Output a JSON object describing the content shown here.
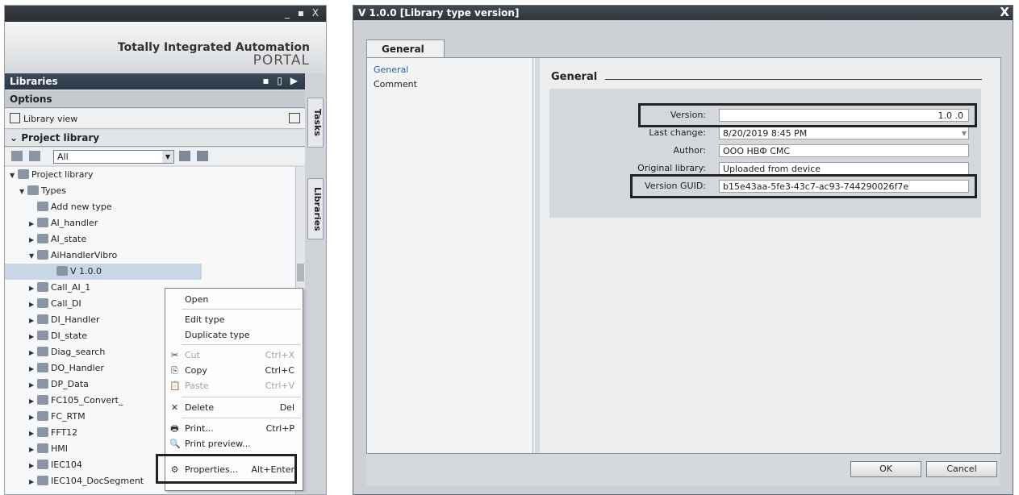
{
  "left_panel": {
    "window_controls": "_ ▪ X",
    "brand_line1": "Totally Integrated Automation",
    "brand_line2": "PORTAL",
    "libraries_title": "Libraries",
    "options_label": "Options",
    "library_view_label": "Library view",
    "project_library_section": "Project library",
    "filter_value": "All",
    "vertical_tabs": [
      "Tasks",
      "Libraries"
    ],
    "tree": [
      {
        "label": "Project library",
        "indent": 0,
        "arrow": "▼"
      },
      {
        "label": "Types",
        "indent": 1,
        "arrow": "▼"
      },
      {
        "label": "Add new type",
        "indent": 2,
        "arrow": ""
      },
      {
        "label": "AI_handler",
        "indent": 2,
        "arrow": "▶"
      },
      {
        "label": "AI_state",
        "indent": 2,
        "arrow": "▶"
      },
      {
        "label": "AiHandlerVibro",
        "indent": 2,
        "arrow": "▼"
      },
      {
        "label": "V 1.0.0",
        "indent": 4,
        "arrow": "",
        "selected": true
      },
      {
        "label": "Call_AI_1",
        "indent": 2,
        "arrow": "▶"
      },
      {
        "label": "Call_DI",
        "indent": 2,
        "arrow": "▶"
      },
      {
        "label": "DI_Handler",
        "indent": 2,
        "arrow": "▶"
      },
      {
        "label": "DI_state",
        "indent": 2,
        "arrow": "▶"
      },
      {
        "label": "Diag_search",
        "indent": 2,
        "arrow": "▶"
      },
      {
        "label": "DO_Handler",
        "indent": 2,
        "arrow": "▶"
      },
      {
        "label": "DP_Data",
        "indent": 2,
        "arrow": "▶"
      },
      {
        "label": "FC105_Convert_",
        "indent": 2,
        "arrow": "▶"
      },
      {
        "label": "FC_RTM",
        "indent": 2,
        "arrow": "▶"
      },
      {
        "label": "FFT12",
        "indent": 2,
        "arrow": "▶"
      },
      {
        "label": "HMI",
        "indent": 2,
        "arrow": "▶"
      },
      {
        "label": "IEC104",
        "indent": 2,
        "arrow": "▶"
      },
      {
        "label": "IEC104_DocSegment",
        "indent": 2,
        "arrow": "▶"
      }
    ]
  },
  "context_menu": {
    "items": [
      {
        "label": "Open",
        "shortcut": "",
        "icon": "",
        "disabled": false
      },
      {
        "label": "Edit type",
        "shortcut": "",
        "icon": "",
        "disabled": false
      },
      {
        "label": "Duplicate type",
        "shortcut": "",
        "icon": "",
        "disabled": false
      },
      {
        "label": "Cut",
        "shortcut": "Ctrl+X",
        "icon": "✂",
        "disabled": true
      },
      {
        "label": "Copy",
        "shortcut": "Ctrl+C",
        "icon": "⎘",
        "disabled": false
      },
      {
        "label": "Paste",
        "shortcut": "Ctrl+V",
        "icon": "📋",
        "disabled": true
      },
      {
        "label": "Delete",
        "shortcut": "Del",
        "icon": "✕",
        "disabled": false
      },
      {
        "label": "Print...",
        "shortcut": "Ctrl+P",
        "icon": "🖶",
        "disabled": false
      },
      {
        "label": "Print preview...",
        "shortcut": "",
        "icon": "🔍",
        "disabled": false
      },
      {
        "label": "Properties...",
        "shortcut": "Alt+Enter",
        "icon": "⚙",
        "disabled": false
      }
    ]
  },
  "dialog": {
    "title": "V 1.0.0 [Library type version]",
    "close": "X",
    "tab_label": "General",
    "nav_items": [
      "General",
      "Comment"
    ],
    "section_title": "General",
    "fields": {
      "version_label": "Version:",
      "version_value": "1.0 .0",
      "last_change_label": "Last change:",
      "last_change_value": "8/20/2019 8:45 PM",
      "author_label": "Author:",
      "author_value": "ООО НВФ СМС",
      "original_library_label": "Original library:",
      "original_library_value": "Uploaded from device",
      "version_guid_label": "Version GUID:",
      "version_guid_value": "b15e43aa-5fe3-43c7-ac93-744290026f7e"
    },
    "ok_label": "OK",
    "cancel_label": "Cancel"
  }
}
